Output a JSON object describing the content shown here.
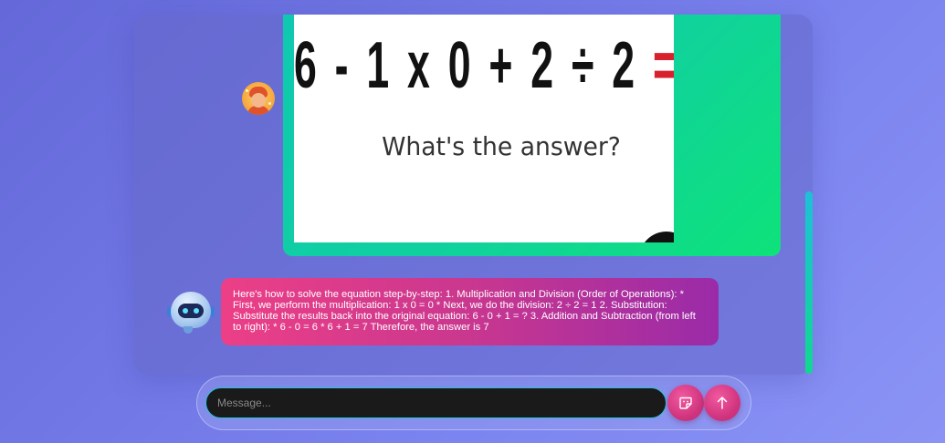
{
  "conversation": {
    "user_image": {
      "equation_text": "6 - 1 x 0 + 2 ÷ 2 ",
      "equation_suffix": "= ?",
      "question_text": "What's the answer?"
    },
    "bot_message": "Here's how to solve the equation step-by-step: 1. Multiplication and Division (Order of Operations): * First, we perform the multiplication: 1 x 0 = 0 * Next, we do the division: 2 ÷ 2 = 1 2. Substitution: Substitute the results back into the original equation: 6 - 0 + 1 = ? 3. Addition and Subtraction (from left to right): * 6 - 0 = 6 * 6 + 1 = 7 Therefore, the answer is 7"
  },
  "composer": {
    "placeholder": "Message...",
    "value": ""
  },
  "icons": {
    "user_avatar": "user-avatar-icon",
    "bot_avatar": "robot-avatar-icon",
    "sticker": "sticker-icon",
    "send": "arrow-up-icon"
  },
  "colors": {
    "background": "#6a70e0",
    "image_frame": "#10d0a0",
    "bot_bubble_start": "#ec3f87",
    "bot_bubble_end": "#9a2ba8",
    "button": "#d1357f",
    "input_border": "#24c4d8"
  }
}
